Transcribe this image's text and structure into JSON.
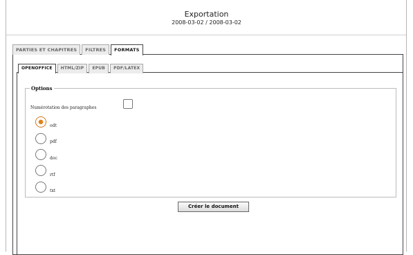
{
  "header": {
    "title": "Exportation",
    "subtitle": "2008-03-02 / 2008-03-02"
  },
  "outer_tabs": [
    {
      "label": "PARTIES ET CHAPITRES"
    },
    {
      "label": "FILTRES"
    },
    {
      "label": "FORMATS",
      "active": true
    }
  ],
  "inner_tabs": [
    {
      "label": "OPENOFFICE",
      "active": true
    },
    {
      "label": "HTML/ZIP"
    },
    {
      "label": "EPUB"
    },
    {
      "label": "PDF/LATEX"
    }
  ],
  "options": {
    "legend": "Options",
    "numbering_label": "Numérotation des paragraphes",
    "numbering_checked": false,
    "formats": [
      {
        "label": "odt",
        "checked": true
      },
      {
        "label": "pdf",
        "checked": false
      },
      {
        "label": "doc",
        "checked": false
      },
      {
        "label": "rtf",
        "checked": false
      },
      {
        "label": "txt",
        "checked": false
      }
    ]
  },
  "actions": {
    "create_label": "Créer le document"
  }
}
